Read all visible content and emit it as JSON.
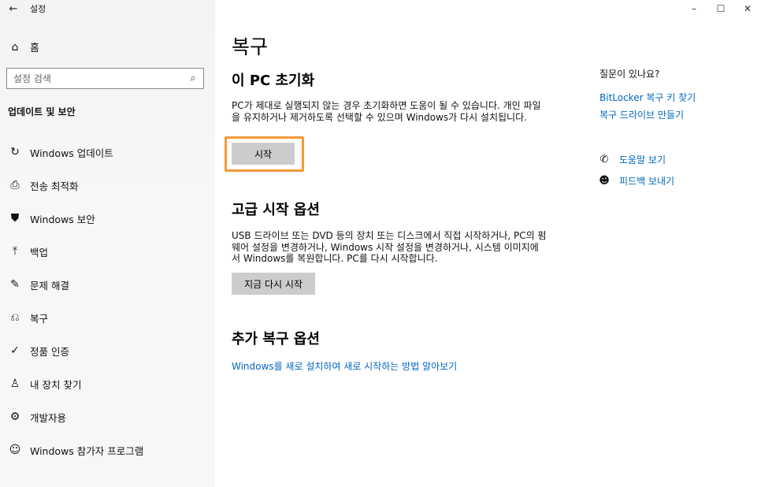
{
  "titlebar": {
    "back_icon": "back-arrow-icon",
    "back_glyph": "←",
    "title": "설정",
    "minimize_glyph": "–",
    "maximize_glyph": "☐",
    "close_glyph": "✕"
  },
  "sidebar": {
    "home_label": "홈",
    "home_glyph": "⌂",
    "search_placeholder": "설정 검색",
    "search_glyph": "⌕",
    "section_label": "업데이트 및 보안",
    "items": [
      {
        "label": "Windows 업데이트",
        "icon": "sync-icon",
        "glyph": "↻"
      },
      {
        "label": "전송 최적화",
        "icon": "delivery-optimization-icon",
        "glyph": "⎙"
      },
      {
        "label": "Windows 보안",
        "icon": "shield-icon",
        "glyph": "⛊"
      },
      {
        "label": "백업",
        "icon": "backup-icon",
        "glyph": "⤒"
      },
      {
        "label": "문제 해결",
        "icon": "wrench-icon",
        "glyph": "✎"
      },
      {
        "label": "복구",
        "icon": "recovery-icon",
        "glyph": "⎌"
      },
      {
        "label": "정품 인증",
        "icon": "check-circle-icon",
        "glyph": "✓"
      },
      {
        "label": "내 장치 찾기",
        "icon": "person-location-icon",
        "glyph": "♙"
      },
      {
        "label": "개발자용",
        "icon": "developer-icon",
        "glyph": "⚙"
      },
      {
        "label": "Windows 참가자 프로그램",
        "icon": "insider-icon",
        "glyph": "☺"
      }
    ]
  },
  "main": {
    "title": "복구",
    "reset": {
      "heading": "이 PC 초기화",
      "description": "PC가 제대로 실행되지 않는 경우 초기화하면 도움이 될 수 있습니다. 개인 파일을 유지하거나 제거하도록 선택할 수 있으며 Windows가 다시 설치됩니다.",
      "button": "시작"
    },
    "advanced": {
      "heading": "고급 시작 옵션",
      "description": "USB 드라이브 또는 DVD 등의 장치 또는 디스크에서 직접 시작하거나, PC의 펌웨어 설정을 변경하거나, Windows 시작 설정을 변경하거나, 시스템 이미지에서 Windows를 복원합니다. PC를 다시 시작합니다.",
      "button": "지금 다시 시작"
    },
    "more": {
      "heading": "추가 복구 옵션",
      "link": "Windows를 새로 설치하여 새로 시작하는 방법 알아보기"
    }
  },
  "aside": {
    "title": "질문이 있나요?",
    "links": [
      "BitLocker 복구 키 찾기",
      "복구 드라이브 만들기"
    ],
    "help_label": "도움말 보기",
    "help_glyph": "✆",
    "feedback_label": "피드백 보내기",
    "feedback_glyph": "☻"
  }
}
